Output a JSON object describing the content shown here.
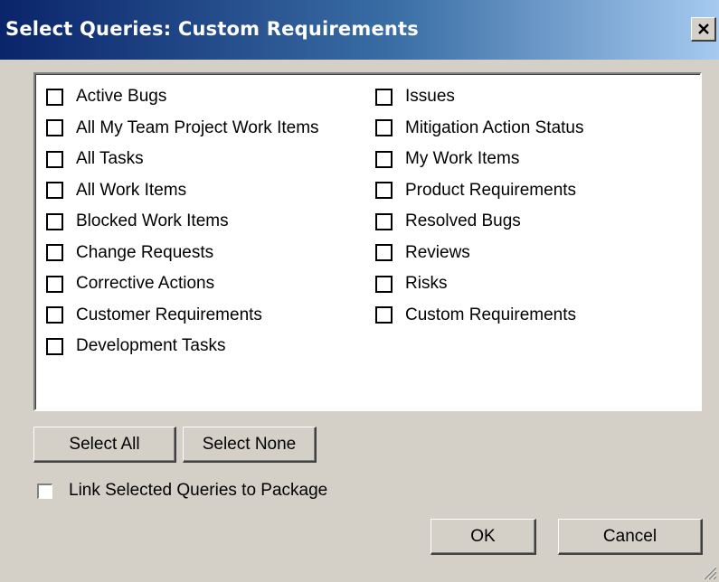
{
  "window": {
    "title": "Select Queries: Custom Requirements",
    "close_glyph": "×"
  },
  "queries": {
    "left": [
      {
        "label": "Active Bugs",
        "checked": false
      },
      {
        "label": "All My Team Project Work Items",
        "checked": false
      },
      {
        "label": "All Tasks",
        "checked": false
      },
      {
        "label": "All Work Items",
        "checked": false
      },
      {
        "label": "Blocked Work Items",
        "checked": false
      },
      {
        "label": "Change Requests",
        "checked": false
      },
      {
        "label": "Corrective Actions",
        "checked": false
      },
      {
        "label": "Customer Requirements",
        "checked": false
      },
      {
        "label": "Development Tasks",
        "checked": false
      }
    ],
    "right": [
      {
        "label": "Issues",
        "checked": false
      },
      {
        "label": "Mitigation Action Status",
        "checked": false
      },
      {
        "label": "My Work Items",
        "checked": false
      },
      {
        "label": "Product Requirements",
        "checked": false
      },
      {
        "label": "Resolved Bugs",
        "checked": false
      },
      {
        "label": "Reviews",
        "checked": false
      },
      {
        "label": "Risks",
        "checked": false
      },
      {
        "label": "Custom Requirements",
        "checked": false
      }
    ]
  },
  "buttons": {
    "select_all": "Select All",
    "select_none": "Select None",
    "ok": "OK",
    "cancel": "Cancel"
  },
  "link_option": {
    "label": "Link Selected Queries to Package",
    "checked": false
  }
}
